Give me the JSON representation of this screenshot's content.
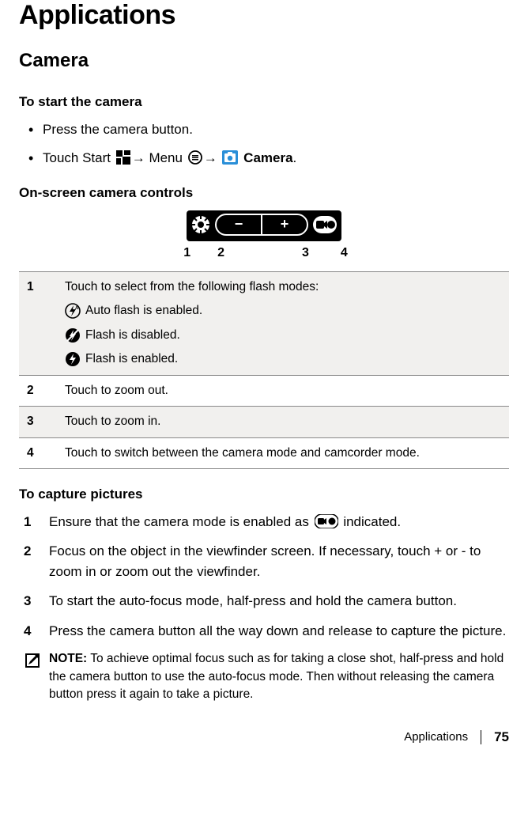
{
  "page": {
    "title": "Applications",
    "section": "Camera",
    "footer_label": "Applications",
    "page_number": "75"
  },
  "start_camera": {
    "heading": "To start the camera",
    "bullet1": "Press the camera button.",
    "bullet2_pre": "Touch Start ",
    "bullet2_arrow1": "→",
    "bullet2_menu": " Menu ",
    "bullet2_arrow2": "→",
    "bullet2_space": " ",
    "bullet2_camera": " Camera",
    "bullet2_period": "."
  },
  "controls": {
    "heading": "On-screen camera controls",
    "callouts": {
      "n1": "1",
      "n2": "2",
      "n3": "3",
      "n4": "4"
    },
    "row1": {
      "num": "1",
      "text": "Touch to select from the following flash modes:",
      "flash_auto": "Auto flash is enabled.",
      "flash_off": "Flash is disabled.",
      "flash_on": "Flash is enabled."
    },
    "row2": {
      "num": "2",
      "text": "Touch to zoom out."
    },
    "row3": {
      "num": "3",
      "text": "Touch to zoom in."
    },
    "row4": {
      "num": "4",
      "text": "Touch to switch between the camera mode and camcorder mode."
    }
  },
  "capture": {
    "heading": "To capture pictures",
    "step1_num": "1",
    "step1_pre": "Ensure that the camera mode is enabled as ",
    "step1_post": " indicated.",
    "step2_num": "2",
    "step2_text": "Focus on the object in the viewfinder screen. If necessary, touch + or - to zoom in or zoom out the viewfinder.",
    "step3_num": "3",
    "step3_text": "To start the auto-focus mode, half-press and hold the camera button.",
    "step4_num": "4",
    "step4_text": "Press the camera button all the way down and release to capture the picture."
  },
  "note": {
    "label": "NOTE:",
    "text": " To achieve optimal focus such as for taking a close shot, half-press and hold the camera button to use the auto-focus mode. Then without releasing the camera button press it again to take a picture."
  }
}
